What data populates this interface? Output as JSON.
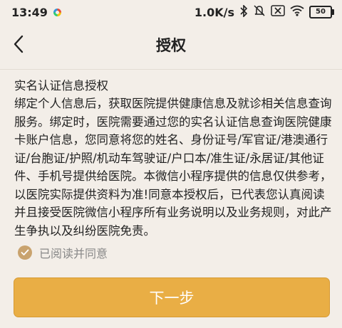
{
  "status_bar": {
    "time": "13:49",
    "network_speed": "1.0K/s",
    "battery": "50",
    "icons": [
      "app-icon",
      "bluetooth-icon",
      "mute-icon",
      "sim-off-icon",
      "wifi-icon",
      "battery-icon"
    ]
  },
  "nav": {
    "back_icon": "chevron-left-icon",
    "title": "授权"
  },
  "auth": {
    "title": "实名认证信息授权",
    "body": "绑定个人信息后，获取医院提供健康信息及就诊相关信息查询服务。绑定时，医院需要通过您的实名认证信息查询医院健康卡账户信息，您同意将您的姓名、身份证号/军官证/港澳通行证/台胞证/护照/机动车驾驶证/户口本/准生证/永居证/其他证件、手机号提供给医院。本微信小程序提供的信息仅供参考，以医院实际提供资料为准!同意本授权后，已代表您认真阅读并且接受医院微信小程序所有业务说明以及业务规则，对此产生争执以及纠纷医院免责。"
  },
  "agreement": {
    "label": "已阅读并同意",
    "checked": true
  },
  "next_button": {
    "label": "下一步"
  },
  "colors": {
    "background": "#F3EEE8",
    "accent": "#E9AE45",
    "check": "#C9A36E"
  }
}
